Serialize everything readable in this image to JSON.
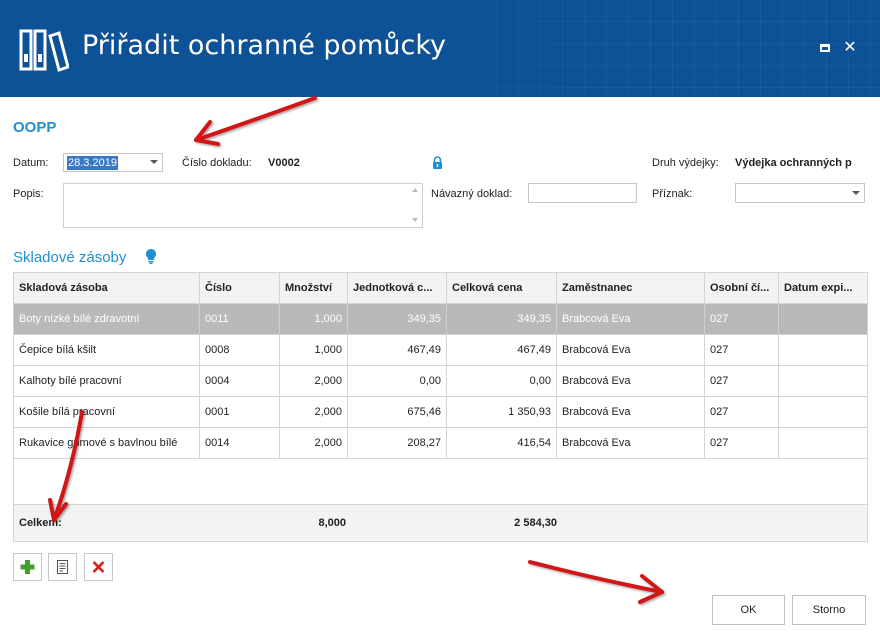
{
  "window": {
    "title": "Přiřadit ochranné pomůcky",
    "controls": [
      "maximize",
      "close"
    ],
    "close_glyph": "✕"
  },
  "form": {
    "section_title": "OOPP",
    "date_label": "Datum:",
    "date_value": "28.3.2019",
    "doc_number_label": "Číslo dokladu:",
    "doc_number_value": "V0002",
    "issue_type_label": "Druh výdejky:",
    "issue_type_value": "Výdejka ochranných p",
    "description_label": "Popis:",
    "description_value": "",
    "related_doc_label": "Návazný doklad:",
    "related_doc_value": "",
    "flag_label": "Příznak:",
    "flag_value": ""
  },
  "stock": {
    "title": "Skladové zásoby",
    "columns": [
      "Skladová zásoba",
      "Číslo",
      "Množství",
      "Jednotková c...",
      "Celková cena",
      "Zaměstnanec",
      "Osobní čí...",
      "Datum expi..."
    ],
    "rows": [
      [
        "Boty nízké bílé zdravotní",
        "0011",
        "1,000",
        "349,35",
        "349,35",
        "Brabcová Eva",
        "027",
        ""
      ],
      [
        "Čepice bílá kšilt",
        "0008",
        "1,000",
        "467,49",
        "467,49",
        "Brabcová Eva",
        "027",
        ""
      ],
      [
        "Kalhoty bílé pracovní",
        "0004",
        "2,000",
        "0,00",
        "0,00",
        "Brabcová Eva",
        "027",
        ""
      ],
      [
        "Košile bílá pracovní",
        "0001",
        "2,000",
        "675,46",
        "1 350,93",
        "Brabcová Eva",
        "027",
        ""
      ],
      [
        "Rukavice gumové s bavlnou bílé",
        "0014",
        "2,000",
        "208,27",
        "416,54",
        "Brabcová Eva",
        "027",
        ""
      ]
    ],
    "selected_row": 0,
    "footer": {
      "label": "Celkem:",
      "quantity_total": "8,000",
      "price_total": "2 584,30"
    }
  },
  "actions": {
    "add_icon": "plus-icon",
    "edit_icon": "edit-icon",
    "delete_icon": "delete-icon",
    "ok_label": "OK",
    "cancel_label": "Storno"
  },
  "colors": {
    "titlebar": "#0d5196",
    "accent": "#1e8fd0",
    "selected_row": "#b9b9b9",
    "annotation_arrow": "#d01818"
  }
}
